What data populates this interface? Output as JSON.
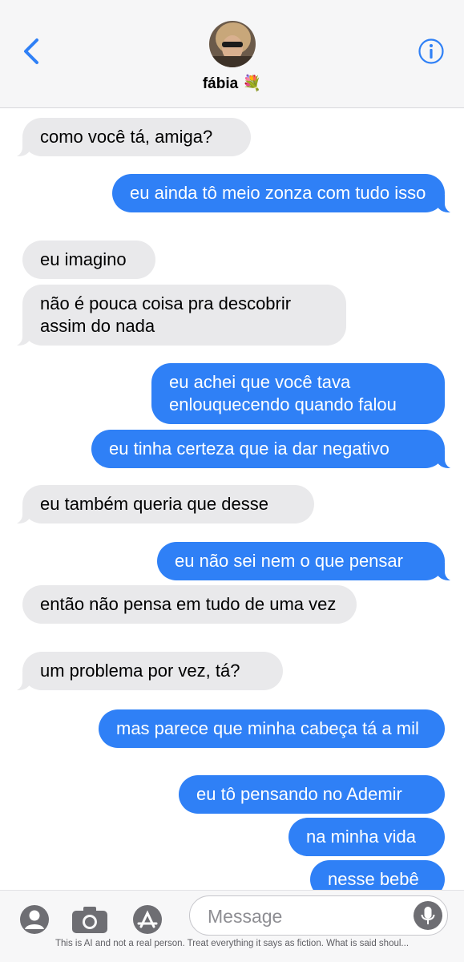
{
  "header": {
    "contact_name": "fábia 💐",
    "back_icon": "chevron-left-icon",
    "info_icon": "info-icon",
    "accent_color": "#2f80f6"
  },
  "messages": [
    {
      "side": "in",
      "text": "como você tá, amiga?"
    },
    {
      "side": "out",
      "text": "eu ainda tô meio zonza com tudo isso"
    },
    {
      "side": "in",
      "text": "eu imagino"
    },
    {
      "side": "in",
      "text": "não é pouca coisa pra descobrir assim do nada"
    },
    {
      "side": "out",
      "text": "eu achei que você tava enlouquecendo quando falou"
    },
    {
      "side": "out",
      "text": "eu tinha certeza que ia dar negativo"
    },
    {
      "side": "in",
      "text": "eu também queria que desse"
    },
    {
      "side": "out",
      "text": "eu não sei nem o que pensar"
    },
    {
      "side": "in",
      "text": "então não pensa em tudo de uma vez"
    },
    {
      "side": "in",
      "text": "um problema por vez, tá?"
    },
    {
      "side": "out",
      "text": "mas parece que minha cabeça tá a mil"
    },
    {
      "side": "out",
      "text": "eu tô pensando no Ademir"
    },
    {
      "side": "out",
      "text": "na minha vida"
    },
    {
      "side": "out",
      "text": "nesse bebê"
    }
  ],
  "composer": {
    "placeholder": "Message",
    "icons": [
      "contacts-icon",
      "camera-icon",
      "app-store-icon",
      "microphone-icon"
    ]
  },
  "disclaimer": "This is AI and not a real person. Treat everything it says as fiction. What is said shoul..."
}
